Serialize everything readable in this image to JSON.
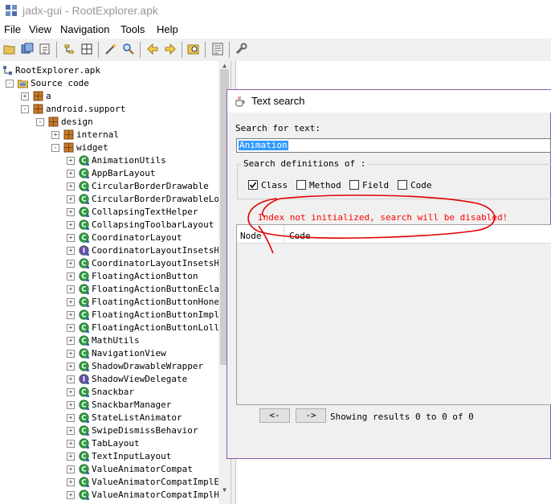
{
  "window": {
    "title": "jadx-gui - RootExplorer.apk"
  },
  "menu": [
    "File",
    "View",
    "Navigation",
    "Tools",
    "Help"
  ],
  "toolbar": {
    "icons": [
      "open-file-icon",
      "save-all-icon",
      "export-icon",
      "sync-tree-icon",
      "flatten-packages-icon",
      "decompile-wand-icon",
      "search-icon",
      "back-icon",
      "forward-icon",
      "find-class-icon",
      "log-viewer-icon",
      "preferences-icon"
    ]
  },
  "tree": {
    "root": "RootExplorer.apk",
    "source": "Source code",
    "pkg_a": "a",
    "pkg_android_support": "android.support",
    "pkg_design": "design",
    "pkg_internal": "internal",
    "pkg_widget": "widget",
    "classes": [
      {
        "name": "AnimationUtils",
        "kind": "class"
      },
      {
        "name": "AppBarLayout",
        "kind": "class"
      },
      {
        "name": "CircularBorderDrawable",
        "kind": "class"
      },
      {
        "name": "CircularBorderDrawableLoll",
        "kind": "class"
      },
      {
        "name": "CollapsingTextHelper",
        "kind": "class"
      },
      {
        "name": "CollapsingToolbarLayout",
        "kind": "class"
      },
      {
        "name": "CoordinatorLayout",
        "kind": "class"
      },
      {
        "name": "CoordinatorLayoutInsetsHel",
        "kind": "interface"
      },
      {
        "name": "CoordinatorLayoutInsetsHel",
        "kind": "class"
      },
      {
        "name": "FloatingActionButton",
        "kind": "class"
      },
      {
        "name": "FloatingActionButtonEclair",
        "kind": "class"
      },
      {
        "name": "FloatingActionButtonHoneyc",
        "kind": "class"
      },
      {
        "name": "FloatingActionButtonImpl",
        "kind": "class"
      },
      {
        "name": "FloatingActionButtonLollip",
        "kind": "class"
      },
      {
        "name": "MathUtils",
        "kind": "class"
      },
      {
        "name": "NavigationView",
        "kind": "class"
      },
      {
        "name": "ShadowDrawableWrapper",
        "kind": "class"
      },
      {
        "name": "ShadowViewDelegate",
        "kind": "interface"
      },
      {
        "name": "Snackbar",
        "kind": "class"
      },
      {
        "name": "SnackbarManager",
        "kind": "class"
      },
      {
        "name": "StateListAnimator",
        "kind": "class"
      },
      {
        "name": "SwipeDismissBehavior",
        "kind": "class"
      },
      {
        "name": "TabLayout",
        "kind": "class"
      },
      {
        "name": "TextInputLayout",
        "kind": "class"
      },
      {
        "name": "ValueAnimatorCompat",
        "kind": "class"
      },
      {
        "name": "ValueAnimatorCompatImplEcl",
        "kind": "class"
      },
      {
        "name": "ValueAnimatorCompatImplHon",
        "kind": "class"
      }
    ]
  },
  "dialog": {
    "title": "Text search",
    "search_label": "Search for text:",
    "search_value": "Animation",
    "definitions_label": "Search definitions of :",
    "options": [
      {
        "label": "Class",
        "checked": true
      },
      {
        "label": "Method",
        "checked": false
      },
      {
        "label": "Field",
        "checked": false
      },
      {
        "label": "Code",
        "checked": false
      }
    ],
    "warning": "Index not initialized, search will be disabled!",
    "columns": [
      "Node",
      "Code"
    ],
    "prev_button": "<-",
    "next_button": "->",
    "results_status": "Showing results 0 to 0 of 0"
  },
  "colors": {
    "class_icon": "#2e9c3f",
    "interface_icon": "#6b4fa8",
    "package_icon": "#c87a2e",
    "warning_text": "#ff0000",
    "dialog_border": "#8a5aa8"
  }
}
